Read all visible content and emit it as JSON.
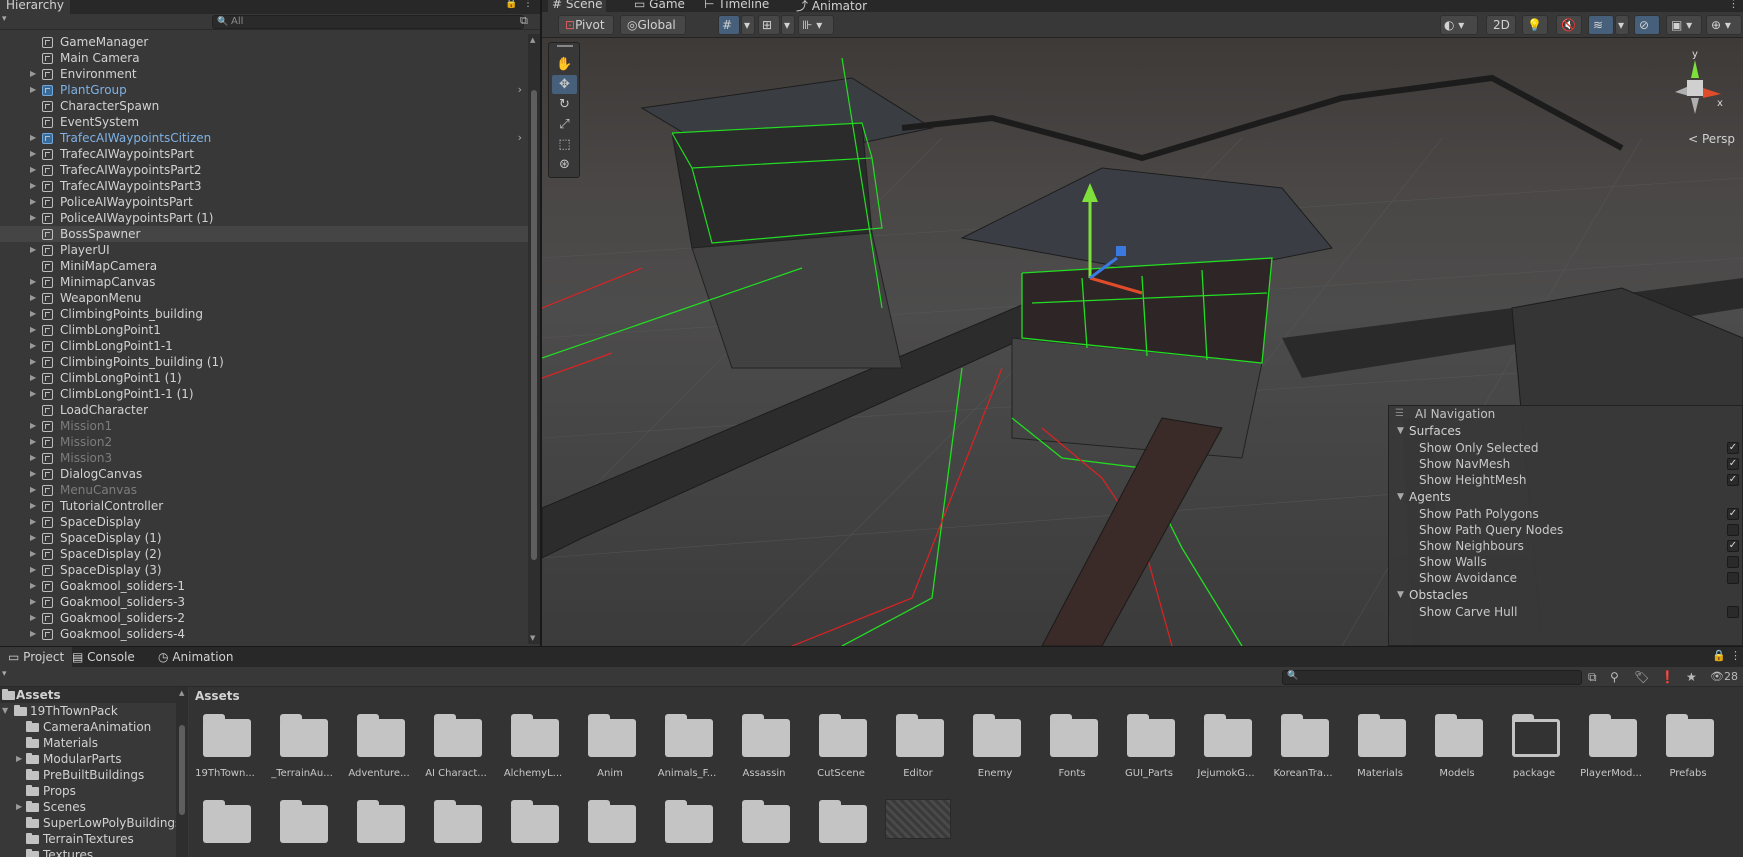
{
  "hierarchy": {
    "title": "Hierarchy",
    "search_placeholder": "All",
    "items": [
      {
        "label": "GameManager",
        "expandable": false,
        "style": "normal"
      },
      {
        "label": "Main Camera",
        "expandable": false,
        "style": "normal"
      },
      {
        "label": "Environment",
        "expandable": true,
        "style": "normal"
      },
      {
        "label": "PlantGroup",
        "expandable": true,
        "style": "prefab"
      },
      {
        "label": "CharacterSpawn",
        "expandable": false,
        "style": "normal"
      },
      {
        "label": "EventSystem",
        "expandable": false,
        "style": "normal"
      },
      {
        "label": "TrafecAIWaypointsCitizen",
        "expandable": true,
        "style": "prefab"
      },
      {
        "label": "TrafecAIWaypointsPart",
        "expandable": true,
        "style": "normal"
      },
      {
        "label": "TrafecAIWaypointsPart2",
        "expandable": true,
        "style": "normal"
      },
      {
        "label": "TrafecAIWaypointsPart3",
        "expandable": true,
        "style": "normal"
      },
      {
        "label": "PoliceAIWaypointsPart",
        "expandable": true,
        "style": "normal"
      },
      {
        "label": "PoliceAIWaypointsPart (1)",
        "expandable": true,
        "style": "normal"
      },
      {
        "label": "BossSpawner",
        "expandable": false,
        "style": "selected"
      },
      {
        "label": "PlayerUI",
        "expandable": true,
        "style": "normal"
      },
      {
        "label": "MiniMapCamera",
        "expandable": false,
        "style": "normal"
      },
      {
        "label": "MinimapCanvas",
        "expandable": true,
        "style": "normal"
      },
      {
        "label": "WeaponMenu",
        "expandable": true,
        "style": "normal"
      },
      {
        "label": "ClimbingPoints_building",
        "expandable": true,
        "style": "normal"
      },
      {
        "label": "ClimbLongPoint1",
        "expandable": true,
        "style": "normal"
      },
      {
        "label": "ClimbLongPoint1-1",
        "expandable": true,
        "style": "normal"
      },
      {
        "label": "ClimbingPoints_building (1)",
        "expandable": true,
        "style": "normal"
      },
      {
        "label": "ClimbLongPoint1 (1)",
        "expandable": true,
        "style": "normal"
      },
      {
        "label": "ClimbLongPoint1-1 (1)",
        "expandable": true,
        "style": "normal"
      },
      {
        "label": "LoadCharacter",
        "expandable": false,
        "style": "normal"
      },
      {
        "label": "Mission1",
        "expandable": true,
        "style": "disabled"
      },
      {
        "label": "Mission2",
        "expandable": true,
        "style": "disabled"
      },
      {
        "label": "Mission3",
        "expandable": true,
        "style": "disabled"
      },
      {
        "label": "DialogCanvas",
        "expandable": true,
        "style": "normal"
      },
      {
        "label": "MenuCanvas",
        "expandable": true,
        "style": "disabled"
      },
      {
        "label": "TutorialController",
        "expandable": true,
        "style": "normal"
      },
      {
        "label": "SpaceDisplay",
        "expandable": true,
        "style": "normal"
      },
      {
        "label": "SpaceDisplay (1)",
        "expandable": true,
        "style": "normal"
      },
      {
        "label": "SpaceDisplay (2)",
        "expandable": true,
        "style": "normal"
      },
      {
        "label": "SpaceDisplay (3)",
        "expandable": true,
        "style": "normal"
      },
      {
        "label": "Goakmool_soliders-1",
        "expandable": true,
        "style": "normal"
      },
      {
        "label": "Goakmool_soliders-3",
        "expandable": true,
        "style": "normal"
      },
      {
        "label": "Goakmool_soliders-2",
        "expandable": true,
        "style": "normal"
      },
      {
        "label": "Goakmool_soliders-4",
        "expandable": true,
        "style": "normal"
      }
    ]
  },
  "scene": {
    "tabs": [
      {
        "label": "Scene",
        "icon": "hash-icon",
        "active": true
      },
      {
        "label": "Game",
        "icon": "gamepad-icon",
        "active": false
      },
      {
        "label": "Timeline",
        "icon": "timeline-icon",
        "active": false
      },
      {
        "label": "Animator",
        "icon": "animator-icon",
        "active": false
      }
    ],
    "toolbar": {
      "pivot_label": "Pivot",
      "global_label": "Global",
      "mode_2d": "2D",
      "persp_label": "Persp"
    },
    "gizmo": {
      "y_label": "y",
      "x_label": "x"
    }
  },
  "ai_navigation": {
    "title": "AI Navigation",
    "sections": [
      {
        "name": "Surfaces",
        "items": [
          {
            "label": "Show Only Selected",
            "checked": true
          },
          {
            "label": "Show NavMesh",
            "checked": true
          },
          {
            "label": "Show HeightMesh",
            "checked": true
          }
        ]
      },
      {
        "name": "Agents",
        "items": [
          {
            "label": "Show Path Polygons",
            "checked": true
          },
          {
            "label": "Show Path Query Nodes",
            "checked": false
          },
          {
            "label": "Show Neighbours",
            "checked": true
          },
          {
            "label": "Show Walls",
            "checked": false
          },
          {
            "label": "Show Avoidance",
            "checked": false
          }
        ]
      },
      {
        "name": "Obstacles",
        "items": [
          {
            "label": "Show Carve Hull",
            "checked": false
          }
        ]
      }
    ]
  },
  "project": {
    "tabs": [
      {
        "label": "Project",
        "active": true
      },
      {
        "label": "Console",
        "active": false
      },
      {
        "label": "Animation",
        "active": false
      }
    ],
    "hidden_count": "28",
    "tree": [
      {
        "label": "Assets",
        "depth": 0,
        "arrow": "down",
        "header": true
      },
      {
        "label": "19ThTownPack",
        "depth": 1,
        "arrow": "down",
        "header": false
      },
      {
        "label": "CameraAnimation",
        "depth": 2,
        "arrow": "",
        "header": false
      },
      {
        "label": "Materials",
        "depth": 2,
        "arrow": "",
        "header": false
      },
      {
        "label": "ModularParts",
        "depth": 2,
        "arrow": "right",
        "header": false
      },
      {
        "label": "PreBuiltBuildings",
        "depth": 2,
        "arrow": "",
        "header": false
      },
      {
        "label": "Props",
        "depth": 2,
        "arrow": "",
        "header": false
      },
      {
        "label": "Scenes",
        "depth": 2,
        "arrow": "right",
        "header": false
      },
      {
        "label": "SuperLowPolyBuildings",
        "depth": 2,
        "arrow": "",
        "header": false
      },
      {
        "label": "TerrainTextures",
        "depth": 2,
        "arrow": "",
        "header": false
      },
      {
        "label": "Textures",
        "depth": 2,
        "arrow": "",
        "header": false
      }
    ],
    "breadcrumb": "Assets",
    "assets": [
      {
        "label": "19ThTown...",
        "empty": false
      },
      {
        "label": "_TerrainAu...",
        "empty": false
      },
      {
        "label": "Adventure...",
        "empty": false
      },
      {
        "label": "AI Charact...",
        "empty": false
      },
      {
        "label": "AlchemyL...",
        "empty": false
      },
      {
        "label": "Anim",
        "empty": false
      },
      {
        "label": "Animals_F...",
        "empty": false
      },
      {
        "label": "Assassin",
        "empty": false
      },
      {
        "label": "CutScene",
        "empty": false
      },
      {
        "label": "Editor",
        "empty": false
      },
      {
        "label": "Enemy",
        "empty": false
      },
      {
        "label": "Fonts",
        "empty": false
      },
      {
        "label": "GUI_Parts",
        "empty": false
      },
      {
        "label": "JejumokG...",
        "empty": false
      },
      {
        "label": "KoreanTra...",
        "empty": false
      },
      {
        "label": "Materials",
        "empty": false
      },
      {
        "label": "Models",
        "empty": false
      },
      {
        "label": "package",
        "empty": true
      },
      {
        "label": "PlayerMod...",
        "empty": false
      },
      {
        "label": "Prefabs",
        "empty": false
      }
    ],
    "row2_folder_count": 9
  }
}
